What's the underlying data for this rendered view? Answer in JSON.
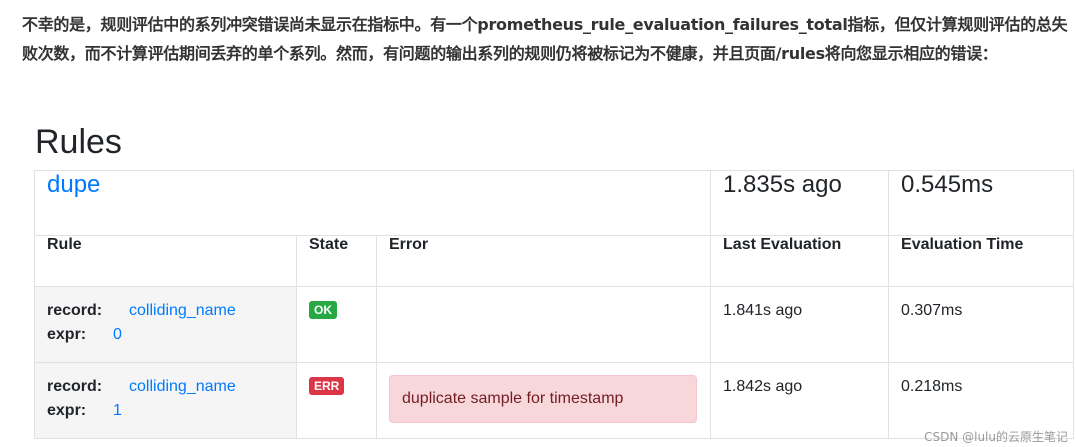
{
  "intro": {
    "text": "不幸的是，规则评估中的系列冲突错误尚未显示在指标中。有一个prometheus_rule_evaluation_failures_total指标，但仅计算规则评估的总失败次数，而不计算评估期间丢弃的单个系列。然而，有问题的输出系列的规则仍将被标记为不健康，并且页面/rules将向您显示相应的错误："
  },
  "page": {
    "title": "Rules"
  },
  "group": {
    "name": "dupe",
    "last_evaluation": "1.835s ago",
    "evaluation_time": "0.545ms"
  },
  "columns": {
    "rule": "Rule",
    "state": "State",
    "error": "Error",
    "last_evaluation": "Last Evaluation",
    "evaluation_time": "Evaluation Time"
  },
  "labels": {
    "record": "record:",
    "expr": "expr:"
  },
  "rules": [
    {
      "record": "colliding_name",
      "expr": "0",
      "state": "OK",
      "error": "",
      "last_evaluation": "1.841s ago",
      "evaluation_time": "0.307ms"
    },
    {
      "record": "colliding_name",
      "expr": "1",
      "state": "ERR",
      "error": "duplicate sample for timestamp",
      "last_evaluation": "1.842s ago",
      "evaluation_time": "0.218ms"
    }
  ],
  "watermark": "CSDN @lulu的云原生笔记",
  "colors": {
    "link": "#007bff",
    "ok": "#28a745",
    "err": "#dc3545",
    "error_bg": "#f8d7da",
    "error_text": "#721c24"
  }
}
